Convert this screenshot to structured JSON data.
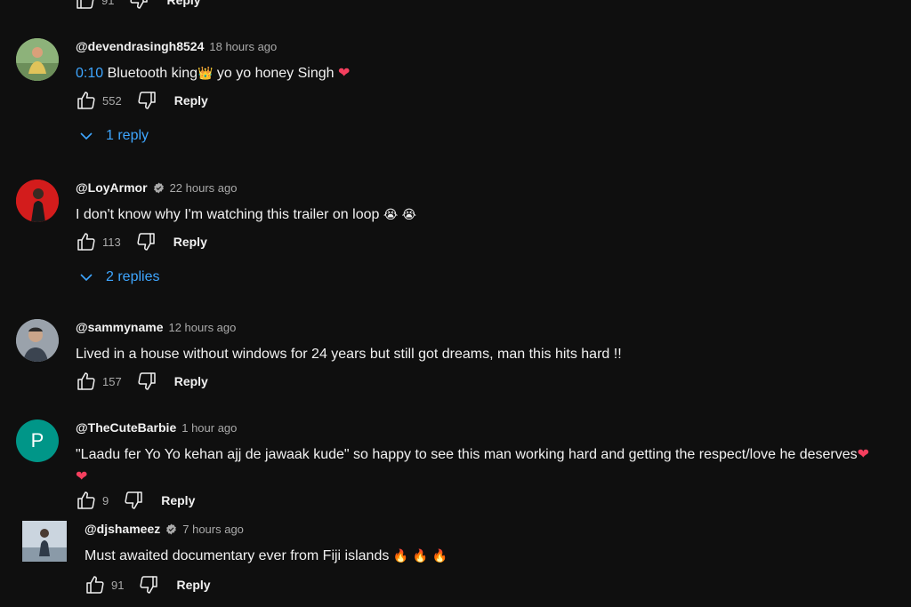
{
  "top_partial": {
    "like_count": "91",
    "reply_label": "Reply"
  },
  "comments": [
    {
      "author": "@devendrasingh8524",
      "time": "18 hours ago",
      "timestamp": "0:10",
      "text_before": " Bluetooth king",
      "text_after": " yo yo honey Singh",
      "likes": "552",
      "reply_label": "Reply",
      "replies_label": "1 reply"
    },
    {
      "author": "@LoyArmor",
      "time": "22 hours ago",
      "text": "I don't know why I'm watching this trailer on loop",
      "likes": "113",
      "reply_label": "Reply",
      "replies_label": "2 replies"
    },
    {
      "author": "@sammyname",
      "time": "12 hours ago",
      "text": "Lived in a house without windows for 24 years but still got dreams, man this hits hard !!",
      "likes": "157",
      "reply_label": "Reply"
    },
    {
      "author": "@TheCuteBarbie",
      "time": "1 hour ago",
      "avatar_letter": "P",
      "avatar_color": "#009688",
      "text": "\"Laadu fer Yo Yo kehan ajj de jawaak kude\" so happy to see this man working hard and getting the respect/love he deserves",
      "likes": "9",
      "reply_label": "Reply"
    },
    {
      "author": "@djshameez",
      "time": "7 hours ago",
      "text": "Must awaited documentary ever from Fiji islands",
      "likes": "91",
      "reply_label": "Reply"
    }
  ],
  "colors": {
    "background": "#0f0f0f",
    "link": "#3ea6ff",
    "muted": "#aaaaaa",
    "heart": "#f43f5e"
  }
}
